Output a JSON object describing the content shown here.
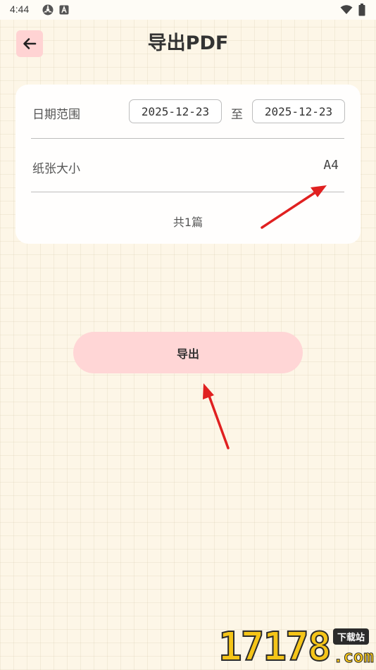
{
  "status_bar": {
    "time": "4:44"
  },
  "header": {
    "title": "导出PDF"
  },
  "form": {
    "date_range_label": "日期范围",
    "start_date": "2025-12-23",
    "to_label": "至",
    "end_date": "2025-12-23",
    "paper_size_label": "纸张大小",
    "paper_size_value": "A4",
    "count_text": "共1篇"
  },
  "actions": {
    "export_label": "导出"
  },
  "watermark": {
    "digits": "17178",
    "tag": "下载站",
    "domain": ".com"
  },
  "colors": {
    "background": "#fdf6e7",
    "accent_pink": "#ffd6d6",
    "annotation_arrow": "#e02020"
  },
  "icons": {
    "back": "arrow-left-icon",
    "status_1": "radar-icon",
    "status_2": "a-badge-icon",
    "wifi": "wifi-icon",
    "battery": "battery-icon"
  }
}
